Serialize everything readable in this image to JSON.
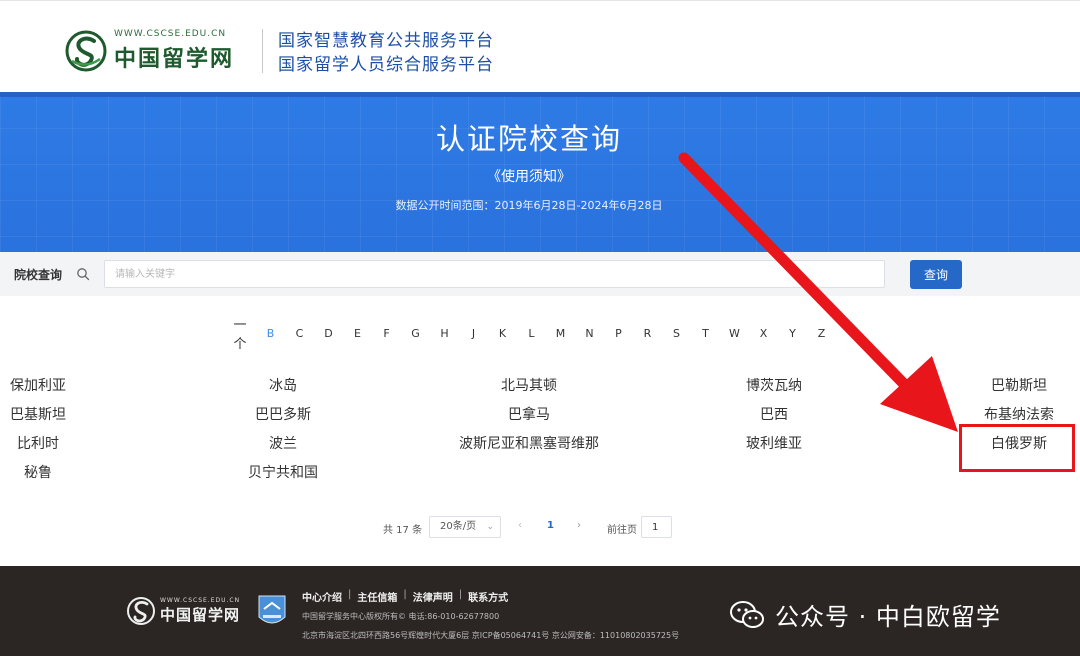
{
  "header": {
    "logo_url": "WWW.CSCSE.EDU.CN",
    "logo_cn": "中国留学网",
    "platform_line1": "国家智慧教育公共服务平台",
    "platform_line2": "国家留学人员综合服务平台"
  },
  "banner": {
    "title": "认证院校查询",
    "notice_link": "《使用须知》",
    "date_range": "数据公开时间范围：2019年6月28日-2024年6月28日"
  },
  "search": {
    "label": "院校查询",
    "placeholder": "请输入关键字",
    "value": "",
    "button_label": "查询"
  },
  "alphabet": {
    "letters": [
      "一个",
      "B",
      "C",
      "D",
      "E",
      "F",
      "G",
      "H",
      "J",
      "K",
      "L",
      "M",
      "N",
      "P",
      "R",
      "S",
      "T",
      "W",
      "X",
      "Y",
      "Z"
    ],
    "active": "B"
  },
  "results": {
    "rows": [
      [
        "保加利亚",
        "冰岛",
        "北马其顿",
        "博茨瓦纳",
        "巴勒斯坦"
      ],
      [
        "巴基斯坦",
        "巴巴多斯",
        "巴拿马",
        "巴西",
        "布基纳法索"
      ],
      [
        "比利时",
        "波兰",
        "波斯尼亚和黑塞哥维那",
        "玻利维亚",
        "白俄罗斯"
      ],
      [
        "秘鲁",
        "贝宁共和国"
      ]
    ],
    "highlighted": "白俄罗斯",
    "annotation_color": "#e8151a"
  },
  "pagination": {
    "total": "共 17 条",
    "page_size": "20条/页",
    "prev": "‹",
    "current_page": "1",
    "next": "›",
    "goto_label": "前往页",
    "goto_value": "1"
  },
  "footer": {
    "logo_url": "WWW.CSCSE.EDU.CN",
    "logo_cn": "中国留学网",
    "links": [
      "中心介绍",
      "主任信箱",
      "法律声明",
      "联系方式"
    ],
    "link_separator": "|",
    "copyright": "中国留学服务中心版权所有©  电话:86-010-62677800",
    "address": "北京市海淀区北四环西路56号辉煌时代大厦6层 京ICP备05064741号 京公网安备：11010802035725号"
  },
  "watermark": {
    "text": "公众号 · 中白欧留学",
    "icon": "wechat-icon"
  },
  "colors": {
    "banner_blue": "#2f7be6",
    "button_blue": "#2568c8",
    "active_letter": "#3d8ee6",
    "footer_bg": "#2b2624"
  }
}
